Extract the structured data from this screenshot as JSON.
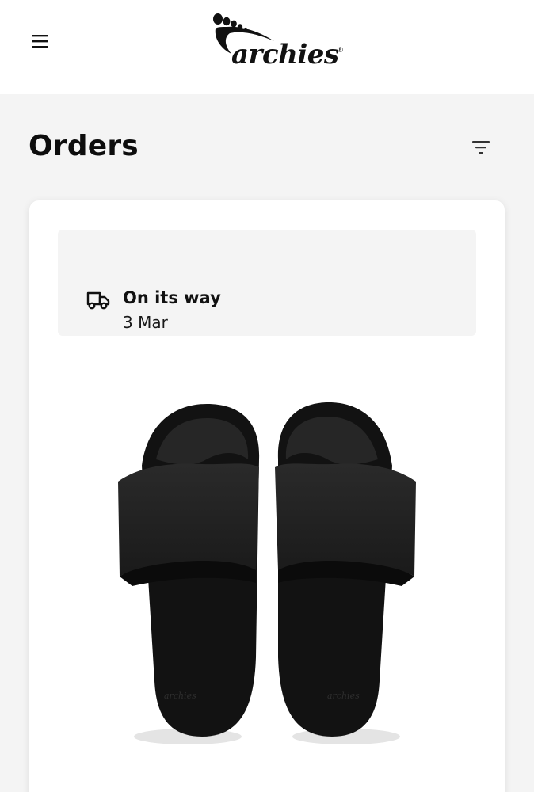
{
  "header": {
    "menu_icon": "hamburger-menu-icon",
    "logo_text": "archies",
    "logo_registered_mark": "®"
  },
  "page": {
    "title": "Orders",
    "filter_icon": "filter-icon"
  },
  "order": {
    "status_icon": "delivery-truck-icon",
    "status": "On its way",
    "date": "3 Mar",
    "product_image": "black slide sandals pair"
  },
  "colors": {
    "page_background": "#f4f4f4",
    "header_background": "#ffffff",
    "card_background": "#ffffff",
    "status_panel_background": "#f4f4f4",
    "text": "#111111"
  }
}
